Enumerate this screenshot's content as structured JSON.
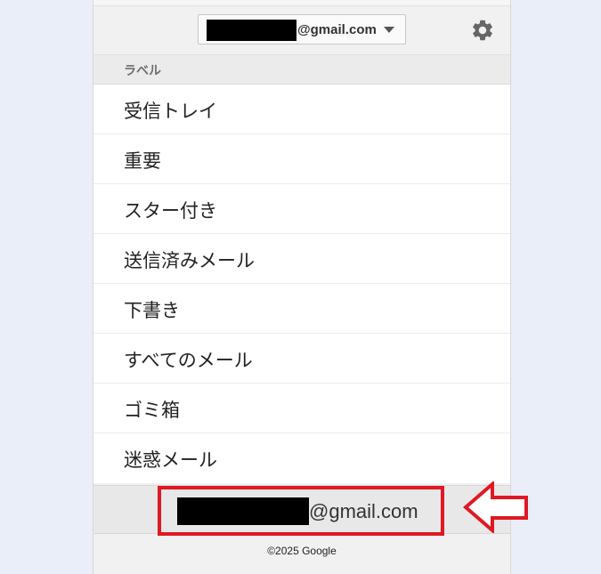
{
  "header": {
    "account_domain": "@gmail.com",
    "settings_icon": "gear-icon",
    "dropdown_icon": "caret-down-icon"
  },
  "labels": {
    "section_title": "ラベル",
    "items": [
      {
        "label": "受信トレイ"
      },
      {
        "label": "重要"
      },
      {
        "label": "スター付き"
      },
      {
        "label": "送信済みメール"
      },
      {
        "label": "下書き"
      },
      {
        "label": "すべてのメール"
      },
      {
        "label": "ゴミ箱"
      },
      {
        "label": "迷惑メール"
      }
    ]
  },
  "footer": {
    "account_domain": "@gmail.com",
    "copyright": "©2025 Google"
  },
  "annotation": {
    "highlight_color": "#e01823",
    "arrow_icon": "left-arrow-icon"
  },
  "colors": {
    "page_background": "#e9eef8",
    "panel_background": "#f1f1f1",
    "list_background": "#ffffff",
    "accent_red": "#e01823"
  }
}
